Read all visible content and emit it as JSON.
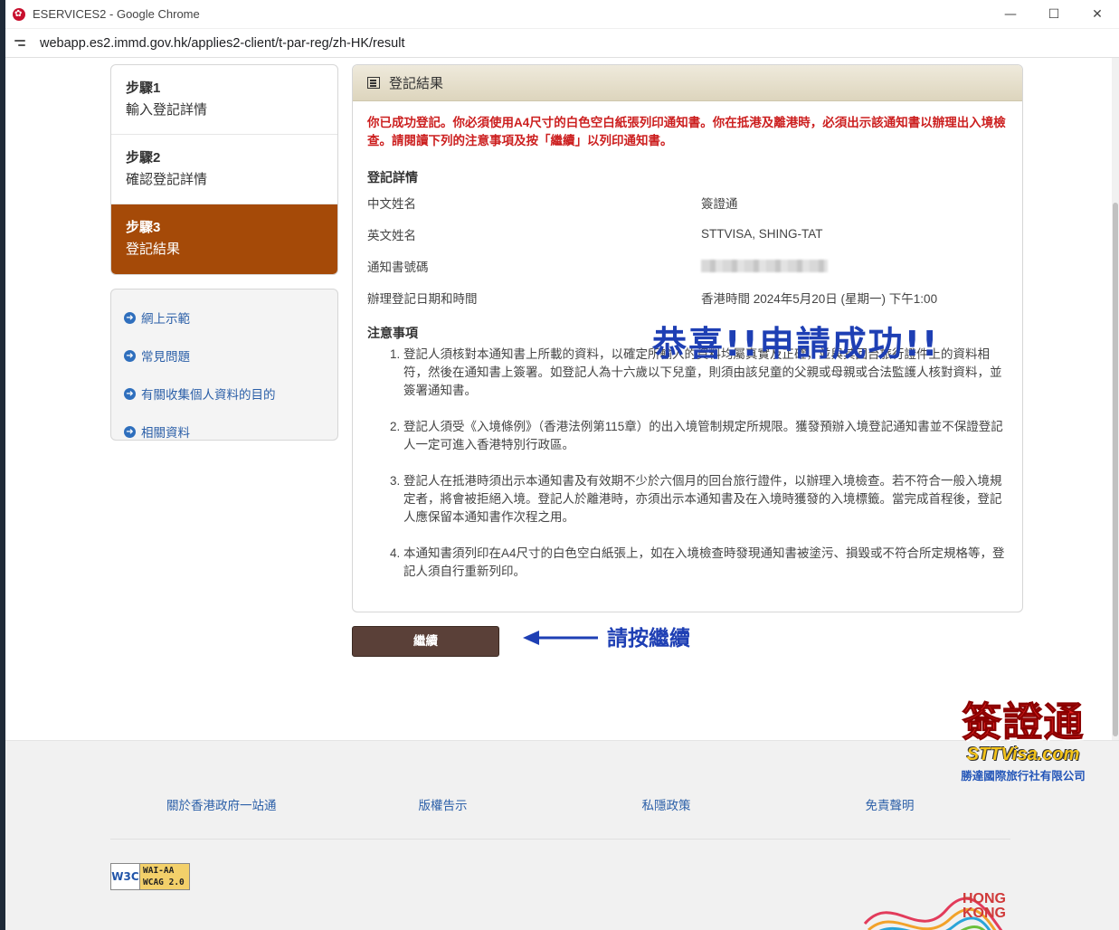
{
  "window": {
    "title": "ESERVICES2 - Google Chrome",
    "url": "webapp.es2.immd.gov.hk/applies2-client/t-par-reg/zh-HK/result"
  },
  "steps": [
    {
      "num": "步驟1",
      "name": "輸入登記詳情"
    },
    {
      "num": "步驟2",
      "name": "確認登記詳情"
    },
    {
      "num": "步驟3",
      "name": "登記結果"
    }
  ],
  "links": [
    "網上示範",
    "常見問題",
    "有關收集個人資料的目的",
    "相關資料"
  ],
  "panel": {
    "title": "登記結果",
    "alert": "你已成功登記。你必須使用A4尺寸的白色空白紙張列印通知書。你在抵港及離港時，必須出示該通知書以辦理出入境檢查。請閱讀下列的注意事項及按「繼續」以列印通知書。",
    "details_title": "登記詳情",
    "details": [
      {
        "label": "中文姓名",
        "value": "簽證通"
      },
      {
        "label": "英文姓名",
        "value": "STTVISA, SHING-TAT"
      },
      {
        "label": "通知書號碼",
        "value": ""
      },
      {
        "label": "辦理登記日期和時間",
        "value": "香港時間 2024年5月20日 (星期一) 下午1:00"
      }
    ],
    "notes_title": "注意事項",
    "notes": [
      "登記人須核對本通知書上所載的資料，以確定所輸入的資料均屬真實及正確，並與其回台旅行證件上的資料相符，然後在通知書上簽署。如登記人為十六歲以下兒童，則須由該兒童的父親或母親或合法監護人核對資料，並簽署通知書。",
      "登記人須受《入境條例》（香港法例第115章）的出入境管制規定所規限。獲發預辦入境登記通知書並不保證登記人一定可進入香港特別行政區。",
      "登記人在抵港時須出示本通知書及有效期不少於六個月的回台旅行證件，以辦理入境檢查。若不符合一般入境規定者，將會被拒絕入境。登記人於離港時，亦須出示本通知書及在入境時獲發的入境標籤。當完成首程後，登記人應保留本通知書作次程之用。",
      "本通知書須列印在A4尺寸的白色空白紙張上，如在入境檢查時發現通知書被塗污、損毀或不符合所定規格等，登記人須自行重新列印。"
    ]
  },
  "overlay": {
    "congrats": "恭喜!!申請成功!!",
    "press_continue": "請按繼續"
  },
  "continue_label": "繼續",
  "footer": {
    "links": [
      "關於香港政府一站通",
      "版權告示",
      "私隱政策",
      "免責聲明"
    ],
    "w3c_logo": "W3C",
    "w3c_line1": "WAI-AA",
    "w3c_line2": "WCAG 2.0"
  },
  "logos": {
    "sttvisa_big": "簽證通",
    "sttvisa_domain": "STTVisa.com",
    "sttvisa_company": "勝達國際旅行社有限公司",
    "hk_line1": "HONG",
    "hk_line2": "KONG"
  },
  "colors": {
    "active_step": "#a54a08",
    "alert": "#cc1f1f",
    "overlay_text": "#1e3fb4",
    "button": "#5a4038"
  }
}
